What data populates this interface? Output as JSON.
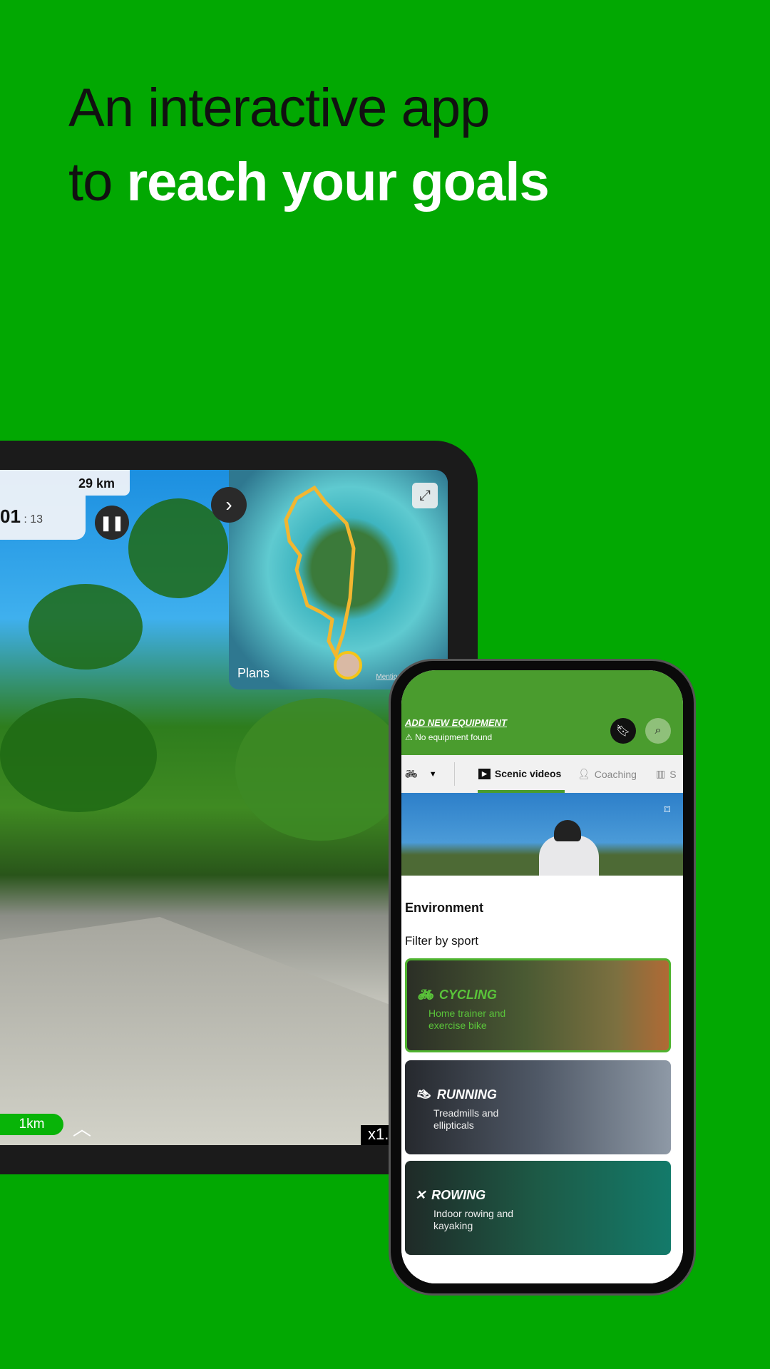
{
  "headline": {
    "line1": "An interactive app",
    "line2_prefix": "to ",
    "line2_highlight": "reach your goals"
  },
  "colors": {
    "background": "#02a802",
    "app_green": "#4a9c2e",
    "highlight": "#ffffff"
  },
  "tablet": {
    "distance": "29 km",
    "time_main": "01",
    "time_sep": " : ",
    "time_sec": "13",
    "map_attribution": "Plans",
    "map_legal": "Mentions",
    "segment_distance": "1km",
    "speed": "x1."
  },
  "phone": {
    "add_equipment": "ADD NEW EQUIPMENT",
    "no_equipment": "No equipment found",
    "tabs": [
      {
        "label": "Scenic videos",
        "icon": "play-icon",
        "active": true
      },
      {
        "label": "Coaching",
        "icon": "coach-icon"
      },
      {
        "label": "S",
        "icon": "bar-chart-icon"
      }
    ],
    "environment": "Environment",
    "filter_by_sport": "Filter by sport",
    "sports": [
      {
        "title": "CYCLING",
        "subtitle": "Home trainer and exercise bike",
        "icon": "bike-icon",
        "selected": true
      },
      {
        "title": "RUNNING",
        "subtitle": "Treadmills and ellipticals",
        "icon": "shoe-icon"
      },
      {
        "title": "ROWING",
        "subtitle": "Indoor rowing and kayaking",
        "icon": "kayak-icon"
      }
    ]
  }
}
